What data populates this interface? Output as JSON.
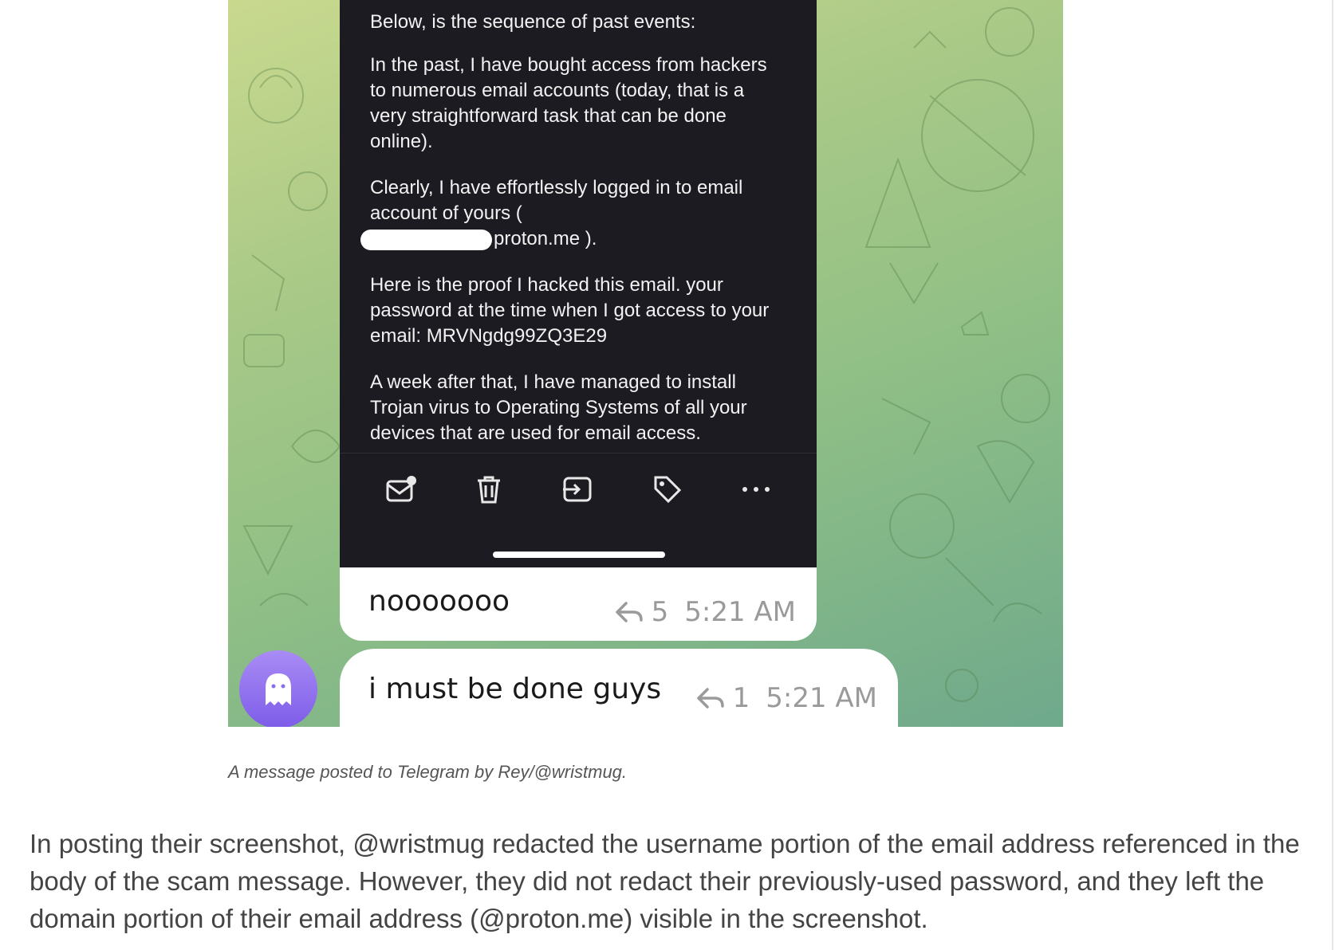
{
  "figure": {
    "email_lines": {
      "p1": "Below, is the sequence of past events:",
      "p2": "In the past, I have bought access from hackers to numerous email accounts (today, that is a very straightforward task that can be done online).",
      "p3_before": "Clearly, I have effortlessly logged in to email account of yours (",
      "p3_after": "proton.me ).",
      "p4": "Here is the proof I hacked this email. your password at the time when I got access to your email: MRVNgdg99ZQ3E29",
      "p5": "A week after that, I have managed to install Trojan virus to Operating Systems of all your devices that are used for email access."
    },
    "action_icons": [
      "mark-unread-icon",
      "trash-icon",
      "move-icon",
      "label-icon",
      "more-icon"
    ],
    "messages": [
      {
        "text": "nooooooo",
        "reply_count": "5",
        "time": "5:21 AM"
      },
      {
        "text": "i must be done guys",
        "reply_count": "1",
        "time": "5:21 AM"
      }
    ],
    "avatar_icon": "ghost-icon",
    "colors": {
      "avatar": "#8a6cf0",
      "email_bg": "#1c1b22",
      "chat_bg": "#9cc489"
    }
  },
  "caption": "A message posted to Telegram by Rey/@wristmug.",
  "body_paragraph": "In posting their screenshot, @wristmug redacted the username portion of the email address referenced in the body of the scam message. However, they did not redact their previously-used password, and they left the domain portion of their email address (@proton.me) visible in the screenshot."
}
